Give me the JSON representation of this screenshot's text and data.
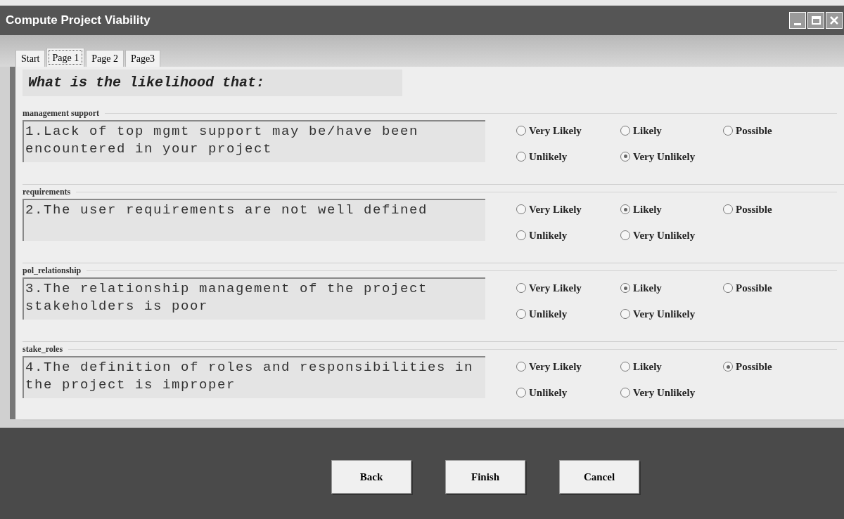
{
  "window": {
    "title": "Compute Project Viability"
  },
  "tabs": [
    {
      "label": "Start",
      "selected": false
    },
    {
      "label": "Page 1",
      "selected": true
    },
    {
      "label": "Page 2",
      "selected": false
    },
    {
      "label": "Page3",
      "selected": false
    }
  ],
  "heading": "What is the likelihood that:",
  "questions": [
    {
      "group": "management support",
      "text": "1.Lack of top mgmt support may be/have been encountered in your project",
      "options": [
        {
          "label": "Very Likely",
          "selected": false
        },
        {
          "label": "Likely",
          "selected": false
        },
        {
          "label": "Possible",
          "selected": false
        },
        {
          "label": "Unlikely",
          "selected": false
        },
        {
          "label": "Very Unlikely",
          "selected": true
        }
      ]
    },
    {
      "group": "requirements",
      "text": "2.The user requirements are not well defined",
      "options": [
        {
          "label": "Very Likely",
          "selected": false
        },
        {
          "label": "Likely",
          "selected": true
        },
        {
          "label": "Possible",
          "selected": false
        },
        {
          "label": "Unlikely",
          "selected": false
        },
        {
          "label": "Very Unlikely",
          "selected": false
        }
      ]
    },
    {
      "group": "pol_relationship",
      "text": "3.The relationship management of the project stakeholders is poor",
      "options": [
        {
          "label": "Very Likely",
          "selected": false
        },
        {
          "label": "Likely",
          "selected": true
        },
        {
          "label": "Possible",
          "selected": false
        },
        {
          "label": "Unlikely",
          "selected": false
        },
        {
          "label": "Very Unlikely",
          "selected": false
        }
      ]
    },
    {
      "group": "stake_roles",
      "text": "4.The definition of roles and responsibilities in the project is improper",
      "options": [
        {
          "label": "Very Likely",
          "selected": false
        },
        {
          "label": "Likely",
          "selected": false
        },
        {
          "label": "Possible",
          "selected": true
        },
        {
          "label": "Unlikely",
          "selected": false
        },
        {
          "label": "Very Unlikely",
          "selected": false
        }
      ]
    }
  ],
  "buttons": [
    "Back",
    "Finish",
    "Cancel"
  ]
}
